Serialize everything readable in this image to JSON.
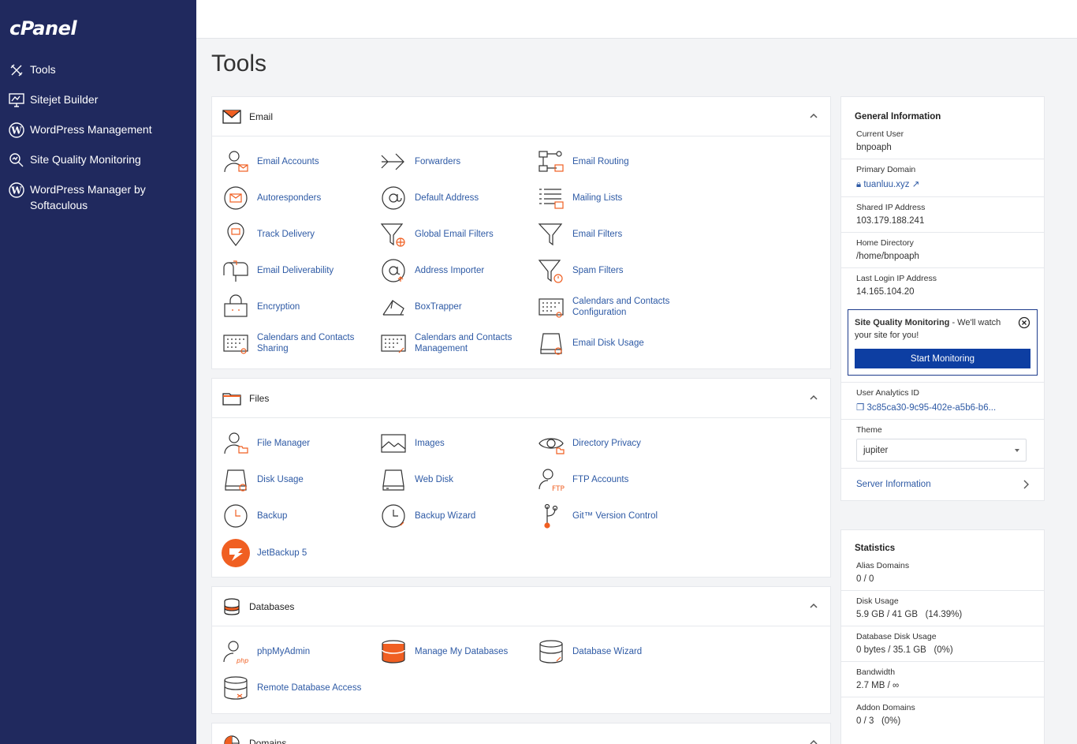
{
  "app": {
    "logo": "cPanel"
  },
  "sidebar": {
    "items": [
      {
        "label": "Tools"
      },
      {
        "label": "Sitejet Builder"
      },
      {
        "label": "WordPress Management"
      },
      {
        "label": "Site Quality Monitoring"
      },
      {
        "label": "WordPress Manager by Softaculous"
      }
    ]
  },
  "page": {
    "title": "Tools"
  },
  "sections": {
    "email": {
      "title": "Email",
      "tools": [
        "Email Accounts",
        "Forwarders",
        "Email Routing",
        "Autoresponders",
        "Default Address",
        "Mailing Lists",
        "Track Delivery",
        "Global Email Filters",
        "Email Filters",
        "Email Deliverability",
        "Address Importer",
        "Spam Filters",
        "Encryption",
        "BoxTrapper",
        "Calendars and Contacts Configuration",
        "Calendars and Contacts Sharing",
        "Calendars and Contacts Management",
        "Email Disk Usage"
      ]
    },
    "files": {
      "title": "Files",
      "tools": [
        "File Manager",
        "Images",
        "Directory Privacy",
        "Disk Usage",
        "Web Disk",
        "FTP Accounts",
        "Backup",
        "Backup Wizard",
        "Git™ Version Control",
        "JetBackup 5"
      ]
    },
    "databases": {
      "title": "Databases",
      "tools": [
        "phpMyAdmin",
        "Manage My Databases",
        "Database Wizard",
        "Remote Database Access"
      ]
    },
    "domains": {
      "title": "Domains"
    }
  },
  "general_info": {
    "title": "General Information",
    "current_user_label": "Current User",
    "current_user": "bnpoaph",
    "primary_domain_label": "Primary Domain",
    "primary_domain": "tuanluu.xyz",
    "shared_ip_label": "Shared IP Address",
    "shared_ip": "103.179.188.241",
    "home_dir_label": "Home Directory",
    "home_dir": "/home/bnpoaph",
    "last_login_label": "Last Login IP Address",
    "last_login": "14.165.104.20",
    "sqm_title": "Site Quality Monitoring",
    "sqm_text": " - We'll watch your site for you!",
    "sqm_button": "Start Monitoring",
    "analytics_label": "User Analytics ID",
    "analytics_id": "3c85ca30-9c95-402e-a5b6-b6...",
    "theme_label": "Theme",
    "theme_value": "jupiter",
    "server_info": "Server Information"
  },
  "statistics": {
    "title": "Statistics",
    "alias_label": "Alias Domains",
    "alias_value": "0 / 0",
    "disk_label": "Disk Usage",
    "disk_value": "5.9 GB / 41 GB   (14.39%)",
    "db_disk_label": "Database Disk Usage",
    "db_disk_value": "0 bytes / 35.1 GB   (0%)",
    "bandwidth_label": "Bandwidth",
    "bandwidth_value": "2.7 MB / ∞",
    "addon_label": "Addon Domains",
    "addon_value": "0 / 3   (0%)"
  },
  "colors": {
    "sidebar": "#20295e",
    "accent": "#f05f22",
    "link": "#2e5aa5",
    "button": "#0d3ea2"
  }
}
